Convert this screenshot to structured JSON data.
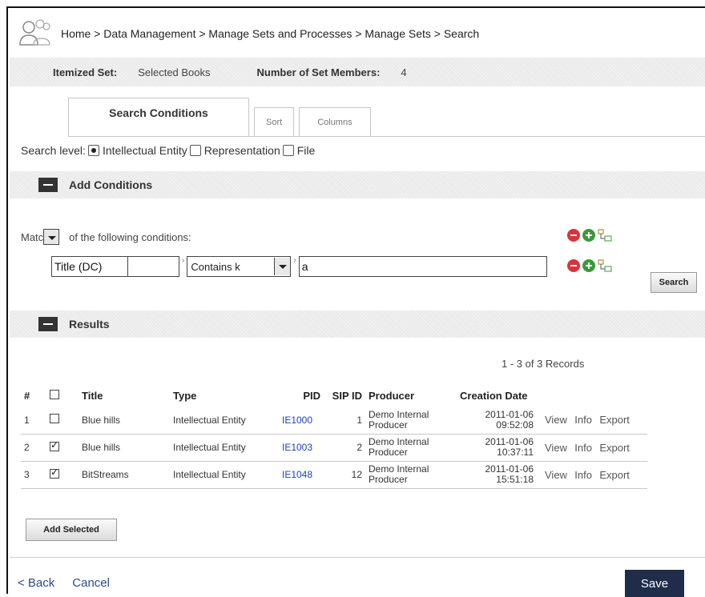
{
  "breadcrumb": "Home > Data Management > Manage Sets and Processes > Manage Sets > Search",
  "set_info": {
    "itemized_label": "Itemized Set:",
    "itemized_value": "Selected Books",
    "members_label": "Number of Set Members:",
    "members_value": "4"
  },
  "tabs": {
    "search_conditions": "Search Conditions",
    "sort": "Sort",
    "columns": "Columns"
  },
  "search_level": {
    "label": "Search level:",
    "options": [
      "Intellectual Entity",
      "Representation",
      "File"
    ],
    "selected": "Intellectual Entity"
  },
  "add_conditions": {
    "title": "Add Conditions",
    "match_prefix": "Matc",
    "match_suffix": "of the following conditions:",
    "condition": {
      "field": "Title (DC)",
      "operator": "Contains k",
      "value": "a"
    },
    "search_button": "Search"
  },
  "results": {
    "title": "Results",
    "records_text": "1 - 3 of 3  Records",
    "headers": [
      "#",
      "Title",
      "Type",
      "PID",
      "SIP ID",
      "Producer",
      "Creation Date"
    ],
    "rows": [
      {
        "num": "1",
        "checked": false,
        "title": "Blue hills",
        "type": "Intellectual Entity",
        "pid": "IE1000",
        "sip": "1",
        "producer_1": "Demo Internal",
        "producer_2": "Producer",
        "date": "2011-01-06",
        "time": "09:52:08"
      },
      {
        "num": "2",
        "checked": true,
        "title": "Blue hills",
        "type": "Intellectual Entity",
        "pid": "IE1003",
        "sip": "2",
        "producer_1": "Demo Internal",
        "producer_2": "Producer",
        "date": "2011-01-06",
        "time": "10:37:11"
      },
      {
        "num": "3",
        "checked": true,
        "title": "BitStreams",
        "type": "Intellectual Entity",
        "pid": "IE1048",
        "sip": "12",
        "producer_1": "Demo Internal",
        "producer_2": "Producer",
        "date": "2011-01-06",
        "time": "15:51:18"
      }
    ],
    "actions": {
      "view": "View",
      "info": "Info",
      "export": "Export"
    },
    "add_selected": "Add Selected"
  },
  "footer": {
    "back": "< Back",
    "cancel": "Cancel",
    "save": "Save"
  },
  "colors": {
    "link": "#1a40c8",
    "save_bg": "#1f2d4a",
    "remove_icon": "#d9343c",
    "add_icon": "#3a9a3a"
  }
}
